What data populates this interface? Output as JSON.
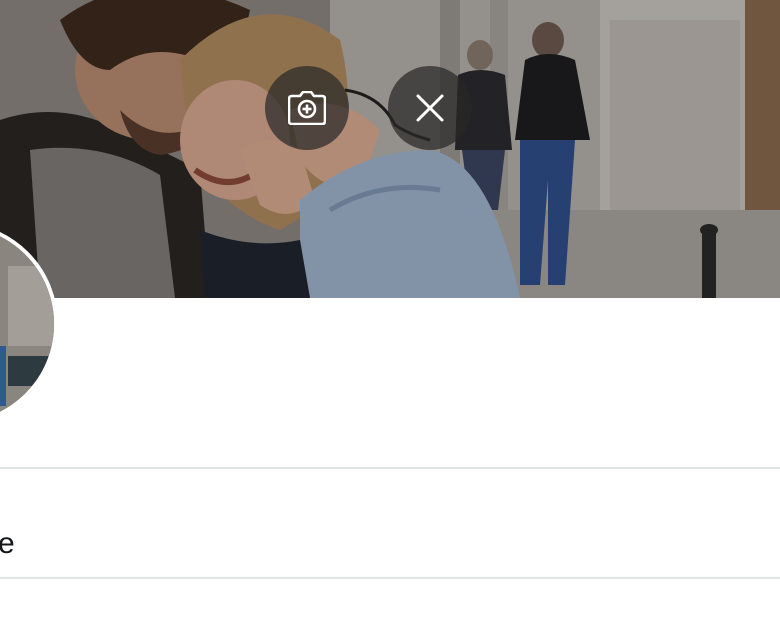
{
  "header": {
    "photo_icon": "header-photo",
    "actions": {
      "add_photo_icon": "camera-plus-icon",
      "remove_photo_icon": "close-icon"
    }
  },
  "profile": {
    "avatar_icon": "avatar"
  },
  "form": {
    "visible_field_text": "e"
  },
  "colors": {
    "overlay_button": "#282828",
    "divider": "#dfe5e5",
    "text": "#14171a",
    "background": "#ffffff"
  }
}
